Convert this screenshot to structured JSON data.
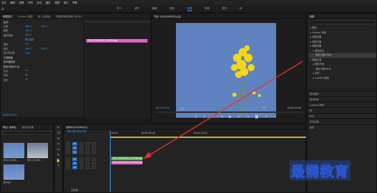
{
  "menu": [
    "文件",
    "编辑",
    "剪辑",
    "序列",
    "标记",
    "图形",
    "视图",
    "窗口",
    "帮助"
  ],
  "workspace_tabs": [
    "学习",
    "组件",
    "编辑",
    "颜色",
    "效果",
    "音频",
    "图形",
    "库"
  ],
  "workspace_active": 4,
  "effect_controls": {
    "tabs": [
      "效果控件",
      "Lumetri 范围",
      "源: (无剪辑)",
      "音频剪辑混合器: 序列01"
    ],
    "active_tab": 0,
    "rows": [
      {
        "type": "section",
        "label": "运动"
      },
      {
        "label": "位置",
        "v1": "960.0",
        "v2": "540.0"
      },
      {
        "label": "缩放",
        "v1": "100.0"
      },
      {
        "label": "缩放宽度",
        "v1": "100.0"
      },
      {
        "label": "",
        "v1": "等比缩放"
      },
      {
        "label": "旋转",
        "v1": "0.0"
      },
      {
        "label": "锚点",
        "v1": "960.0",
        "v2": "540.0"
      },
      {
        "label": "防闪烁滤镜",
        "v1": "0.00"
      },
      {
        "type": "section",
        "label": "不透明度"
      },
      {
        "type": "section",
        "label": "时间重映射"
      },
      {
        "type": "section",
        "label": "颜色平衡(RGB)"
      },
      {
        "label": "红色",
        "v1": "50"
      },
      {
        "label": "绿色",
        "v1": "50"
      },
      {
        "label": "蓝色",
        "v1": "50"
      }
    ],
    "clip_label": "IMG_20180504_104536.jpg",
    "timecode": "00:00:05:00"
  },
  "program": {
    "title": "节目: 01(20190321)(无)",
    "timecode_left": "00:00:00:00",
    "fit": "适合",
    "quality": "1/2",
    "timecode_right": "00:00:05:00",
    "colors": {
      "sky": "#5f83c0",
      "flower": "#f3d71a",
      "stem": "#7d8a55"
    }
  },
  "effects_panel": {
    "title": "效果",
    "items": [
      {
        "label": "预设",
        "level": 0
      },
      {
        "label": "Lumetri 预设",
        "level": 0
      },
      {
        "label": "音频效果",
        "level": 0
      },
      {
        "label": "音频过渡",
        "level": 0
      },
      {
        "label": "视频效果",
        "level": 0
      },
      {
        "label": "颜色校正",
        "level": 1
      },
      {
        "label": "颜色平衡(RGB)",
        "level": 2,
        "selected": true
      },
      {
        "label": "视频过渡",
        "level": 0
      },
      {
        "label": "颜色平衡",
        "level": 1
      },
      {
        "label": "颜色平衡(HLS)",
        "level": 2
      },
      {
        "label": "过时",
        "level": 1
      },
      {
        "label": "Lumetri 颜色",
        "level": 1
      }
    ],
    "side_sections": [
      "基本图形",
      "基本声音",
      "Lumetri 颜色",
      "库",
      "标记",
      "历史记录",
      "信息"
    ]
  },
  "project": {
    "tabs": [
      "项目: 未命名",
      "媒体浏览器"
    ],
    "items": [
      "IMG_20180...",
      "IMG_20180...",
      "序列01"
    ]
  },
  "timeline": {
    "title": "序列01(20190321)",
    "timecode": "00:00:05:00",
    "ruler": [
      "00:00",
      "00:00:05:00",
      "00:00:10:00"
    ],
    "tracks": [
      "V3",
      "V2",
      "V1",
      "A1",
      "A2",
      "A3"
    ],
    "master": "主声道",
    "clips": [
      {
        "label": "IMG_20180504_104536.jpg",
        "color": "green"
      },
      {
        "label": "IMG_20180504_104536.jpg",
        "color": "pink"
      }
    ]
  },
  "watermark": "最需教育"
}
